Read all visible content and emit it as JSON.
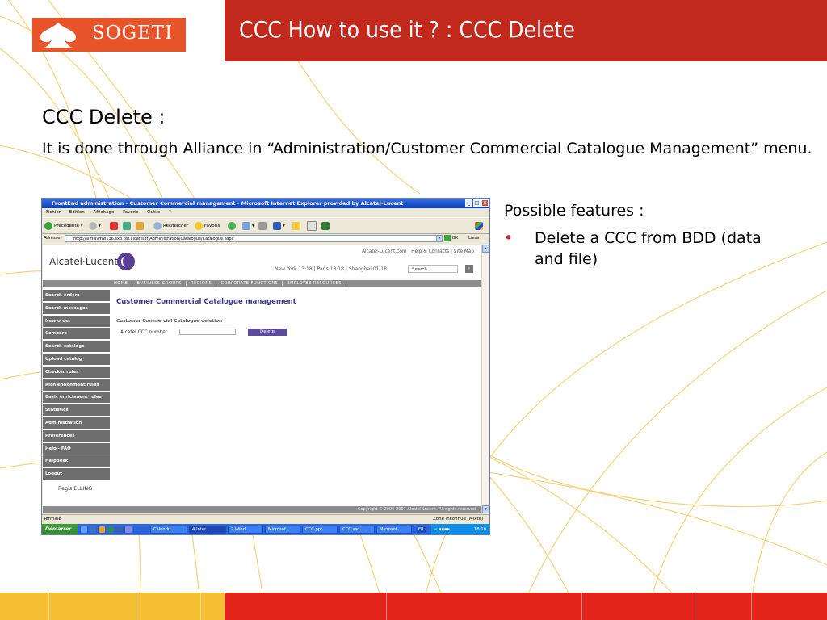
{
  "slide": {
    "title": "CCC How to use it ? : CCC Delete",
    "logo_text": "SOGETI",
    "heading": "CCC Delete :",
    "intro": "It is done through Alliance in “Administration/Customer Commercial Catalogue Management” menu.",
    "features_title": "Possible features :",
    "features": [
      "Delete a CCC from BDD (data and file)"
    ]
  },
  "colors": {
    "brand_red": "#c1291c",
    "brand_orange": "#e8542a",
    "brand_yellow": "#f6c035"
  },
  "browser": {
    "window_title": "FrontEnd administration - Customer Commercial management - Microsoft Internet Explorer provided by Alcatel-Lucent",
    "menu": [
      "Fichier",
      "Edition",
      "Affichage",
      "Favoris",
      "Outils",
      "?"
    ],
    "toolbar": {
      "back": "Précédente",
      "search": "Rechercher",
      "favorites": "Favoris"
    },
    "address_label": "Adresse",
    "url": "http://illmisvmw136.sxb.bsf.alcatel.fr/Administration/Catalogue/Catalogue.aspx",
    "go": "OK",
    "links": "Liens",
    "status_left": "Terminé",
    "status_right": "Zone inconnue (Mixte)"
  },
  "site": {
    "top_links": "Alcatel-Lucent.com  |  Help & Contacts  |  Site Map",
    "logo": "Alcatel·Lucent",
    "cities": "New York 13:18 | Paris 18:18 | Shanghai 01:18",
    "search_placeholder": "Search",
    "nav": [
      "HOME",
      "BUSINESS GROUPS",
      "REGIONS",
      "CORPORATE FUNCTIONS",
      "EMPLOYEE RESOURCES"
    ],
    "sidebar": [
      "Search orders",
      "Search messages",
      "New order",
      "Compare",
      "Search catalogs",
      "Upload catalog",
      "Checker rules",
      "Rich enrichment rules",
      "Basic enrichment rules",
      "Statistics",
      "Administration",
      "Preferences",
      "Help - FAQ",
      "Helpdesk",
      "Logout"
    ],
    "user": "Regis ELLING",
    "page_title": "Customer Commercial Catalogue management",
    "section_title": "Customer Commercial Catalogue deletion",
    "field_label": "Alcatel CCC number",
    "delete_button": "Delete",
    "copyright": "Copyright © 2006-2007 Alcatel-Lucent. All rights reserved"
  },
  "taskbar": {
    "start": "Démarrer",
    "items": [
      "Calendri...",
      "4 Inter...",
      "2 Wind...",
      "Microsof...",
      "CCC.ppt",
      "CCC.vsd...",
      "Microsof..."
    ],
    "lang": "FR",
    "clock": "18:18"
  }
}
